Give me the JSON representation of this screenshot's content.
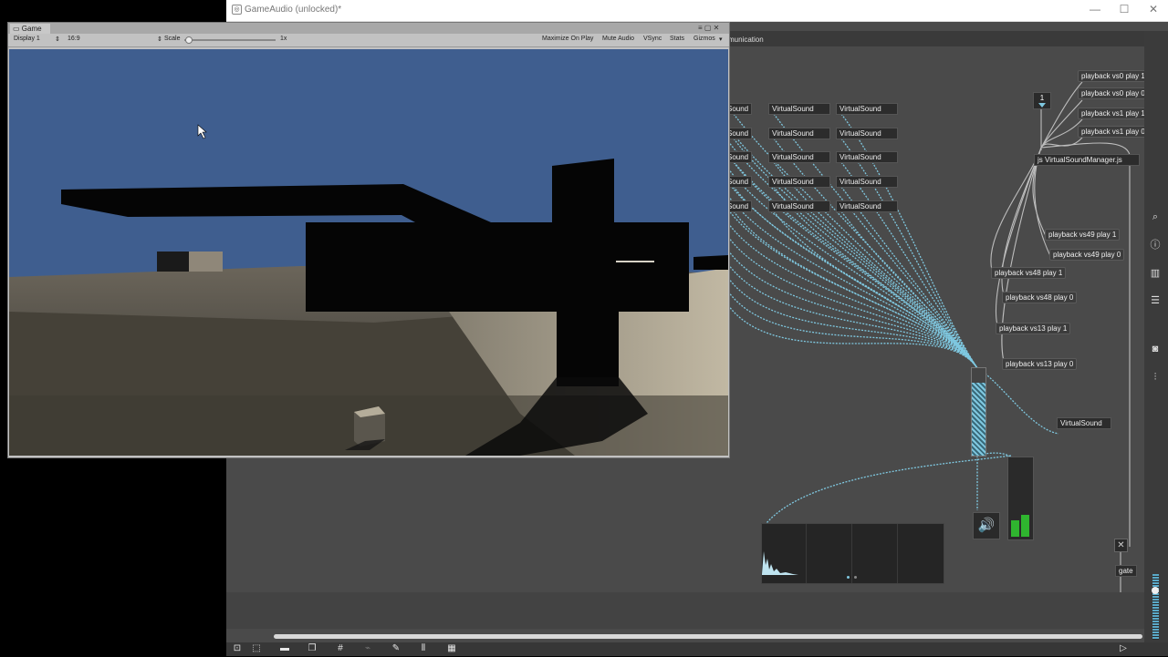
{
  "max_window": {
    "title": "GameAudio (unlocked)*",
    "tab_label": "munication",
    "window_controls": {
      "minimize": "—",
      "maximize": "☐",
      "close": "✕"
    }
  },
  "unity_window": {
    "tab_label": "Game",
    "toolbar": {
      "display": "Display 1",
      "aspect": "16:9",
      "scale_label": "Scale",
      "scale_value": "1x",
      "maximize": "Maximize On Play",
      "mute": "Mute Audio",
      "vsync": "VSync",
      "stats": "Stats",
      "gizmos": "Gizmos"
    }
  },
  "patcher": {
    "virtual_sound_label": "VirtualSound",
    "partial_sound_labels": [
      "Sound",
      "Sound",
      "Sound",
      "Sound",
      "Sound"
    ],
    "virtual_sound_rows": [
      [
        "VirtualSound",
        "VirtualSound"
      ],
      [
        "VirtualSound",
        "VirtualSound"
      ],
      [
        "VirtualSound",
        "VirtualSound"
      ],
      [
        "VirtualSound",
        "VirtualSound"
      ],
      [
        "VirtualSound",
        "VirtualSound"
      ]
    ],
    "number_box": "1",
    "js_object": "js VirtualSoundManager.js",
    "messages_top": [
      "playback vs0 play 1",
      "playback vs0 play 0",
      "playback vs1 play 1",
      "playback vs1 play 0"
    ],
    "messages_mid": [
      "playback vs49 play 1",
      "playback vs49 play 0",
      "playback vs48 play 1",
      "playback vs48 play 0",
      "playback vs13 play 1",
      "playback vs13 play 0"
    ],
    "lone_virtual_sound": "VirtualSound",
    "gate_label": "gate"
  },
  "colors": {
    "max_background": "#4a4a4a",
    "patch_cord": "#7fc8e0",
    "sky": "#3f5e8f",
    "meter_green": "#2fb52f"
  },
  "icons": [
    "search-icon",
    "info-icon",
    "book-icon",
    "list-icon",
    "camera-icon",
    "mixer-icon",
    "power-icon",
    "speaker-icon"
  ]
}
